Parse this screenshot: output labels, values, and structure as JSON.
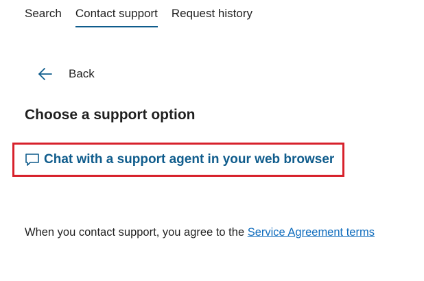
{
  "tabs": [
    {
      "label": "Search",
      "active": false
    },
    {
      "label": "Contact support",
      "active": true
    },
    {
      "label": "Request history",
      "active": false
    }
  ],
  "back": {
    "label": "Back",
    "icon": "arrow-left-icon"
  },
  "main": {
    "title": "Choose a support option",
    "chat_option": {
      "label": "Chat with a support agent in your web browser",
      "icon": "chat-bubble-icon",
      "highlighted": true
    },
    "agreement": {
      "text": "When you contact support, you agree to the",
      "link_label": "Service Agreement terms"
    }
  },
  "colors": {
    "accent": "#0f5c8c",
    "link": "#0f6cbd",
    "highlight_border": "#d7212b",
    "text": "#1f1f1f"
  }
}
